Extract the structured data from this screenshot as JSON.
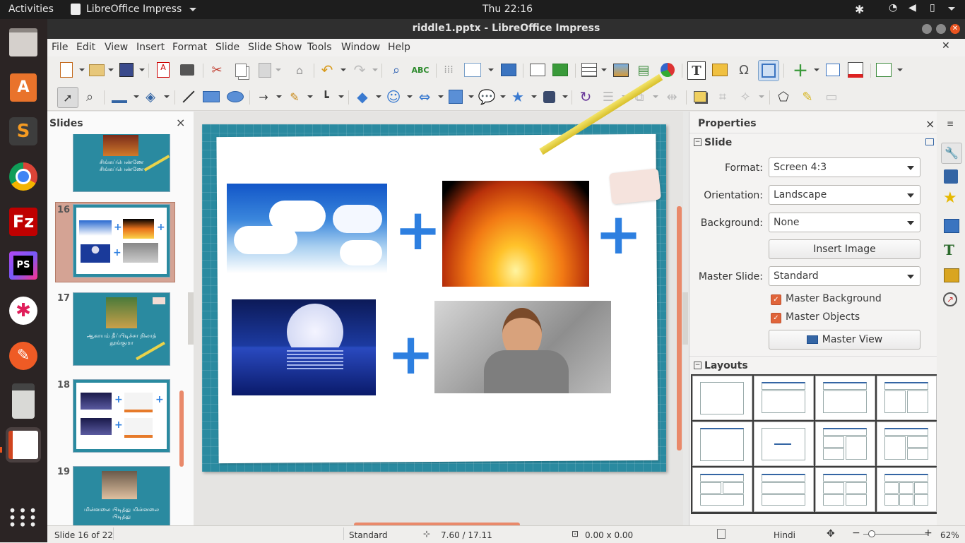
{
  "topbar": {
    "activities": "Activities",
    "app_menu": "LibreOffice Impress",
    "clock": "Thu 22:16"
  },
  "window": {
    "title": "riddle1.pptx - LibreOffice Impress"
  },
  "menu": [
    "File",
    "Edit",
    "View",
    "Insert",
    "Format",
    "Slide",
    "Slide Show",
    "Tools",
    "Window",
    "Help"
  ],
  "slides_pane": {
    "title": "Slides",
    "close": "×",
    "items": [
      {
        "num": "",
        "caption": "சிங்கப்பெண்ணே சிங்கப்பெண்ணே"
      },
      {
        "num": "16",
        "caption": ""
      },
      {
        "num": "17",
        "caption": "ஆகாயம் தீப்பிடிச்சா நிலாத் தூங்குமா"
      },
      {
        "num": "18",
        "caption": ""
      },
      {
        "num": "19",
        "caption": "மின்னலை பிடித்து மின்னலை பிடித்து"
      }
    ]
  },
  "properties": {
    "title": "Properties",
    "close": "×",
    "slide_section": "Slide",
    "format_label": "Format:",
    "format_value": "Screen 4:3",
    "orientation_label": "Orientation:",
    "orientation_value": "Landscape",
    "background_label": "Background:",
    "background_value": "None",
    "insert_image": "Insert Image",
    "master_slide_label": "Master Slide:",
    "master_slide_value": "Standard",
    "master_background": "Master Background",
    "master_objects": "Master Objects",
    "master_view": "Master View",
    "layouts_section": "Layouts"
  },
  "status": {
    "slide": "Slide 16 of 22",
    "master": "Standard",
    "position": "7.60 / 17.11",
    "size": "0.00 x 0.00",
    "language": "Hindi",
    "zoom": "62%"
  },
  "colors": {
    "accent": "#e95420",
    "slide_frame": "#2a8aa0",
    "plus": "#2d7fe0"
  }
}
